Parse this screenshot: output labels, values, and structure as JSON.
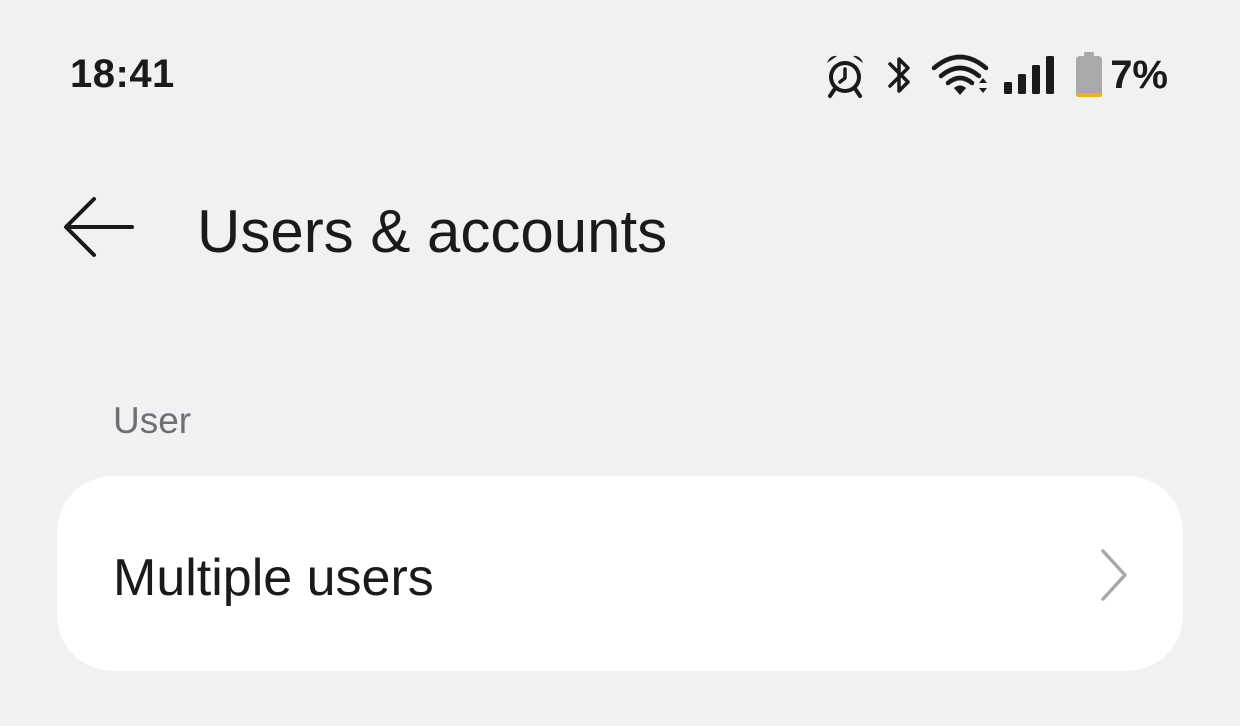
{
  "status_bar": {
    "time": "18:41",
    "battery_percent": "7%",
    "battery_level": 0.07,
    "battery_color": "#f2b01e",
    "icons": [
      "alarm-icon",
      "bluetooth-icon",
      "wifi-icon",
      "cellular-signal-icon",
      "battery-icon"
    ]
  },
  "header": {
    "title": "Users & accounts",
    "back_icon": "back-arrow-icon"
  },
  "sections": [
    {
      "label": "User",
      "items": [
        {
          "label": "Multiple users",
          "icon": "chevron-right-icon"
        }
      ]
    }
  ]
}
